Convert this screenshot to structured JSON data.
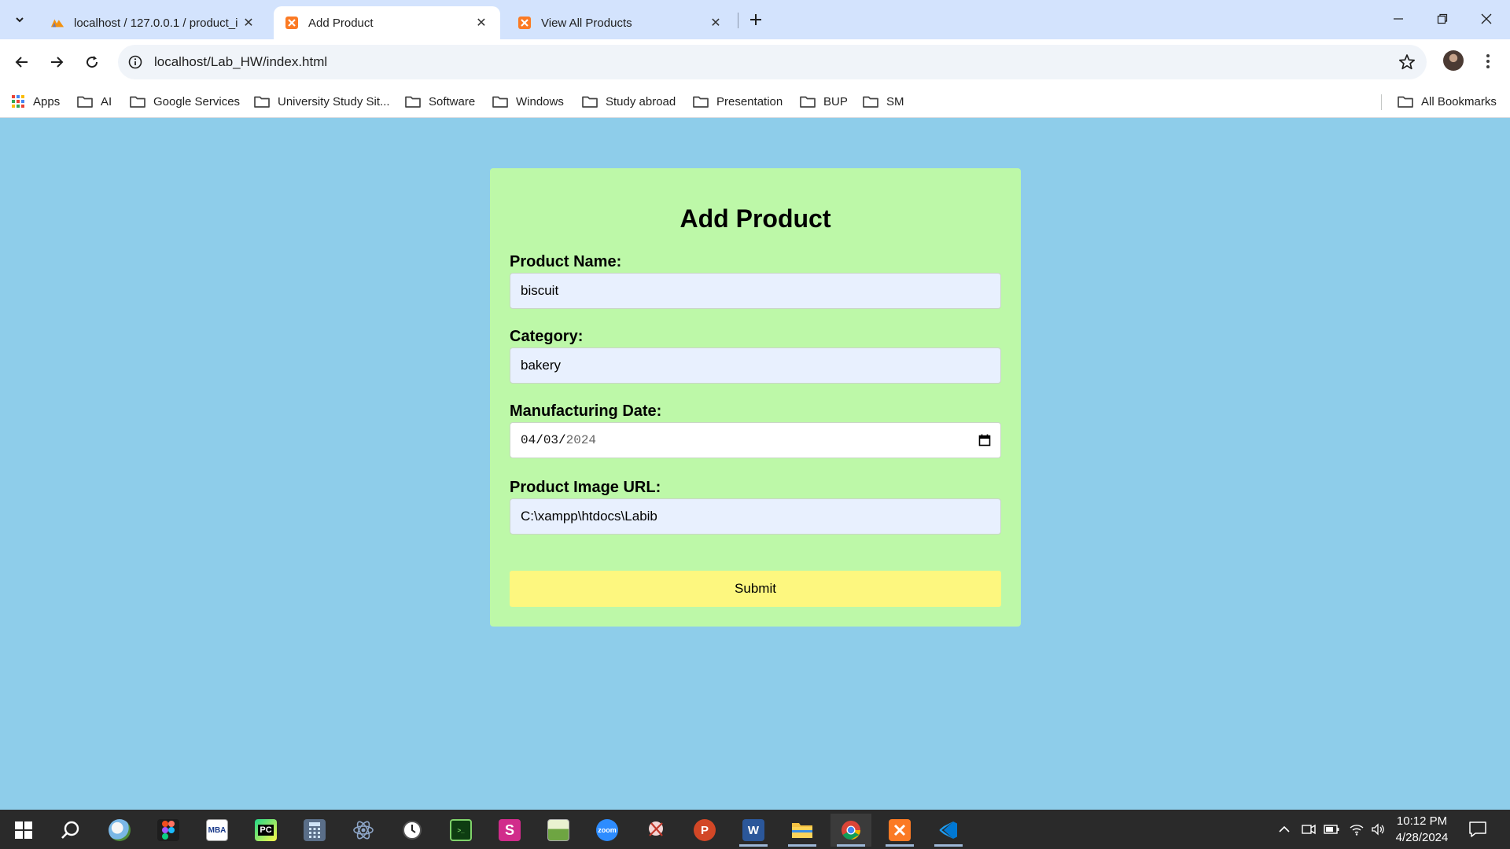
{
  "browser": {
    "tabs": [
      {
        "title": "localhost / 127.0.0.1 / product_i",
        "active": false,
        "favicon": "phpmyadmin-icon"
      },
      {
        "title": "Add Product",
        "active": true,
        "favicon": "xampp-icon"
      },
      {
        "title": "View All Products",
        "active": false,
        "favicon": "xampp-icon"
      }
    ],
    "url": "localhost/Lab_HW/index.html",
    "bookmarks": [
      {
        "label": "Apps",
        "icon": "apps-grid-icon"
      },
      {
        "label": "AI",
        "icon": "folder-icon"
      },
      {
        "label": "Google Services",
        "icon": "folder-icon"
      },
      {
        "label": "University Study Sit...",
        "icon": "folder-icon"
      },
      {
        "label": "Software",
        "icon": "folder-icon"
      },
      {
        "label": "Windows",
        "icon": "folder-icon"
      },
      {
        "label": "Study abroad",
        "icon": "folder-icon"
      },
      {
        "label": "Presentation",
        "icon": "folder-icon"
      },
      {
        "label": "BUP",
        "icon": "folder-icon"
      },
      {
        "label": "SM",
        "icon": "folder-icon"
      }
    ],
    "all_bookmarks": "All Bookmarks"
  },
  "form": {
    "title": "Add Product",
    "product_name": {
      "label": "Product Name:",
      "value": "biscuit"
    },
    "category": {
      "label": "Category:",
      "value": "bakery"
    },
    "manufacturing_date": {
      "label": "Manufacturing Date:",
      "month": "04",
      "day": "03",
      "year": "2024"
    },
    "image_url": {
      "label": "Product Image URL:",
      "value": "C:\\xampp\\htdocs\\Labib"
    },
    "submit_label": "Submit"
  },
  "taskbar": {
    "time": "10:12 PM",
    "date": "4/28/2024"
  },
  "colors": {
    "page_bg": "#8ecdea",
    "card_bg": "#bdf8a8",
    "input_bg": "#e8f0fe",
    "submit_bg": "#fdf77f",
    "tabstrip_bg": "#d3e3fd"
  }
}
